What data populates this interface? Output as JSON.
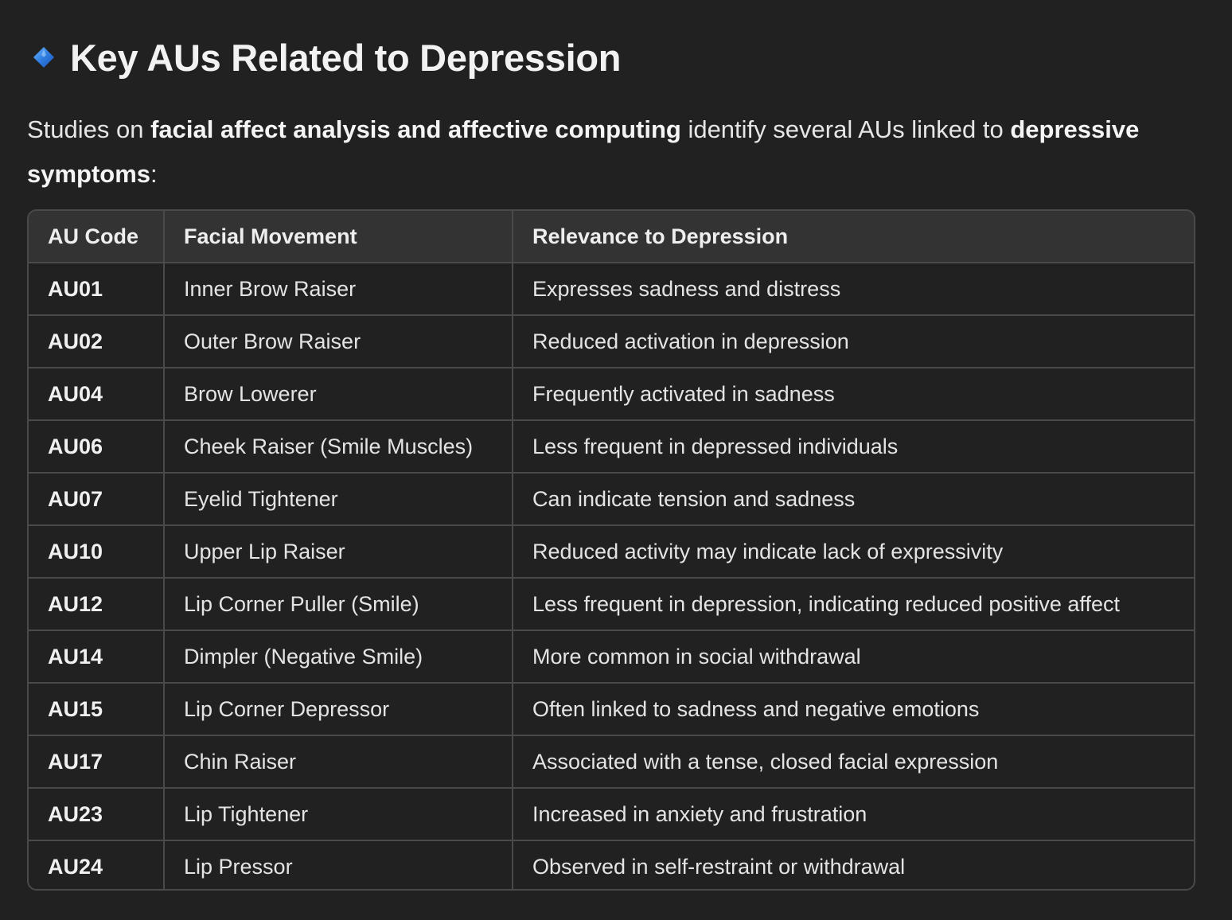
{
  "heading": {
    "icon": "blue-diamond-icon",
    "title": "Key AUs Related to Depression"
  },
  "intro": {
    "part1": "Studies on ",
    "bold1": "facial affect analysis and affective computing",
    "part2": " identify several AUs linked to ",
    "bold2": "depressive symptoms",
    "part3": ":"
  },
  "table": {
    "headers": [
      "AU Code",
      "Facial Movement",
      "Relevance to Depression"
    ],
    "rows": [
      [
        "AU01",
        "Inner Brow Raiser",
        "Expresses sadness and distress"
      ],
      [
        "AU02",
        "Outer Brow Raiser",
        "Reduced activation in depression"
      ],
      [
        "AU04",
        "Brow Lowerer",
        "Frequently activated in sadness"
      ],
      [
        "AU06",
        "Cheek Raiser (Smile Muscles)",
        "Less frequent in depressed individuals"
      ],
      [
        "AU07",
        "Eyelid Tightener",
        "Can indicate tension and sadness"
      ],
      [
        "AU10",
        "Upper Lip Raiser",
        "Reduced activity may indicate lack of expressivity"
      ],
      [
        "AU12",
        "Lip Corner Puller (Smile)",
        "Less frequent in depression, indicating reduced positive affect"
      ],
      [
        "AU14",
        "Dimpler (Negative Smile)",
        "More common in social withdrawal"
      ],
      [
        "AU15",
        "Lip Corner Depressor",
        "Often linked to sadness and negative emotions"
      ],
      [
        "AU17",
        "Chin Raiser",
        "Associated with a tense, closed facial expression"
      ],
      [
        "AU23",
        "Lip Tightener",
        "Increased in anxiety and frustration"
      ],
      [
        "AU24",
        "Lip Pressor",
        "Observed in self-restraint or withdrawal"
      ]
    ]
  },
  "colors": {
    "background": "#212121",
    "header_bg": "#333333",
    "border": "#4a4a4a",
    "icon_blue": "#2f7de1"
  }
}
